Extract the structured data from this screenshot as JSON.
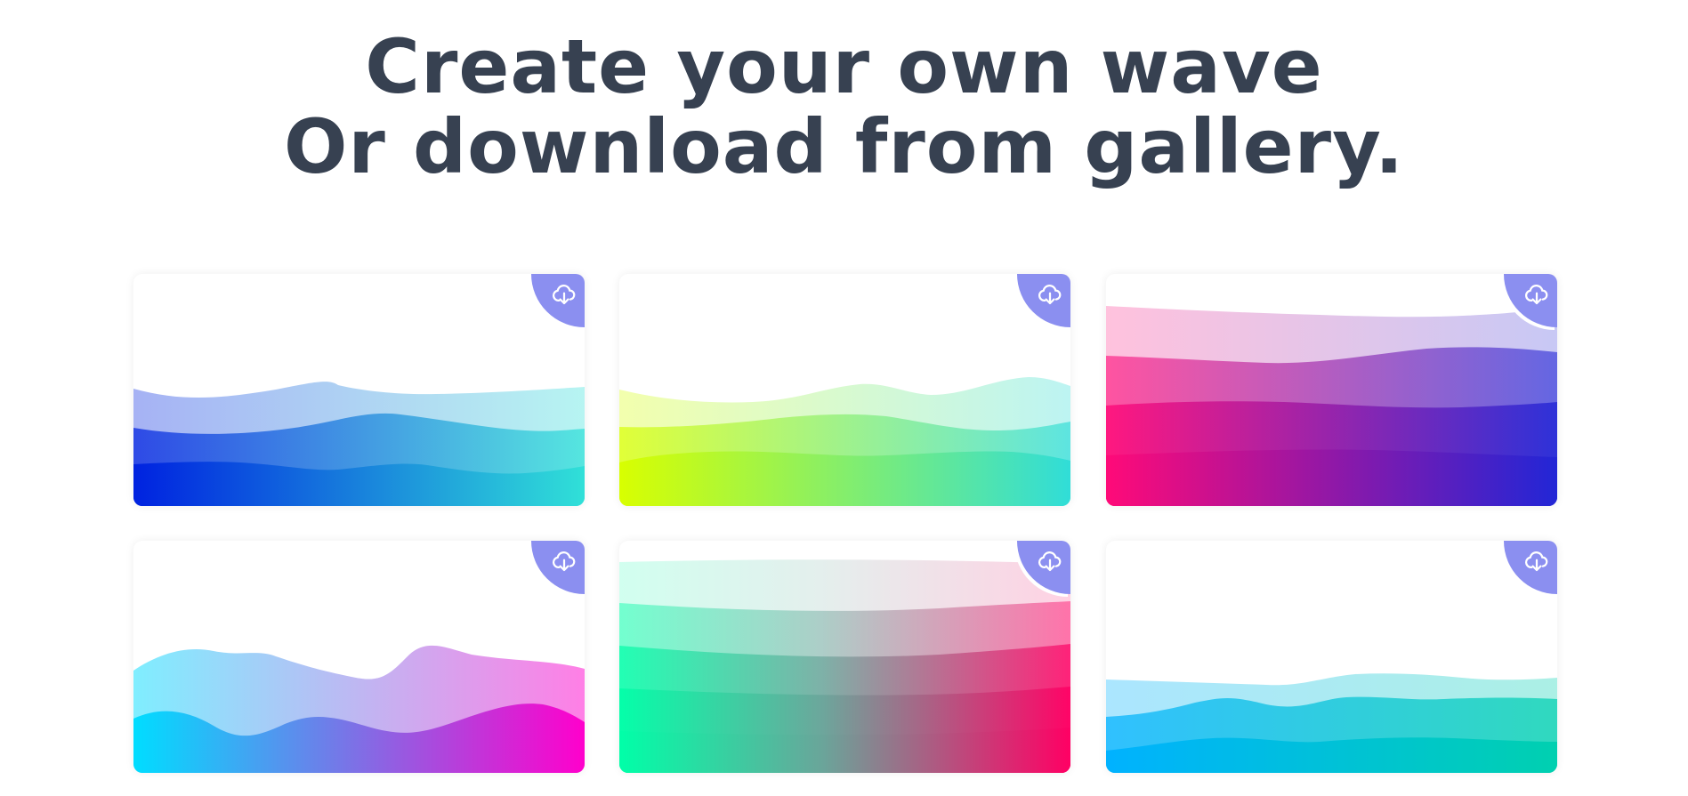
{
  "header": {
    "line1": "Create your own wave",
    "line2": "Or download from gallery."
  },
  "gallery": {
    "download_icon": "cloud-download-icon",
    "button_color": "#8b8ff0",
    "cards": [
      {
        "name": "blue-cyan-waves",
        "colors": [
          "#0022e0",
          "#30e0d8"
        ]
      },
      {
        "name": "lime-teal-waves",
        "colors": [
          "#d8ff00",
          "#30ddd8"
        ]
      },
      {
        "name": "pink-indigo-waves",
        "colors": [
          "#ff0a78",
          "#2226d6"
        ]
      },
      {
        "name": "cyan-magenta-waves",
        "colors": [
          "#00ddff",
          "#ff00cc"
        ]
      },
      {
        "name": "green-pink-layers",
        "colors": [
          "#00ffa8",
          "#ff0064"
        ]
      },
      {
        "name": "sky-teal-waves",
        "colors": [
          "#00b2ff",
          "#00d0b0"
        ]
      }
    ]
  }
}
